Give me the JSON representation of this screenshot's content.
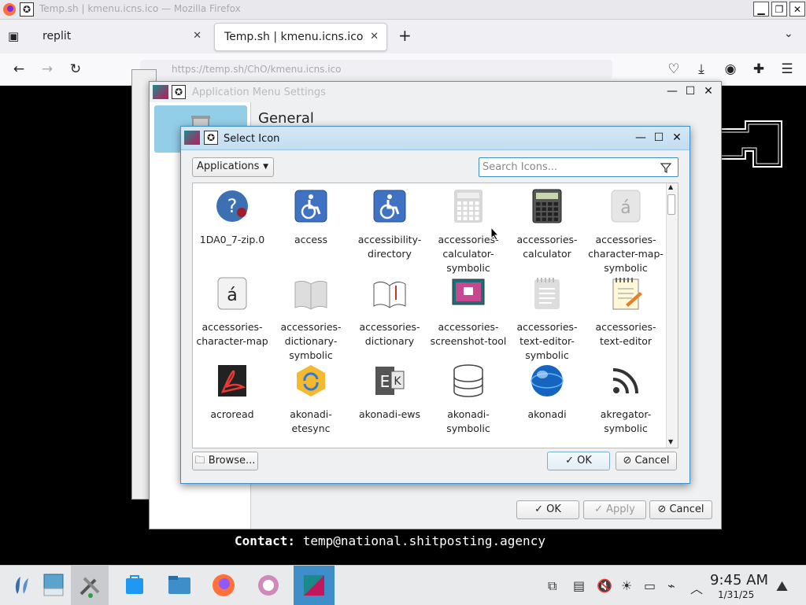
{
  "firefox": {
    "window_title": "Temp.sh | kmenu.icns.ico — Mozilla Firefox",
    "tabs": [
      {
        "label": "replit"
      },
      {
        "label": "Temp.sh | kmenu.icns.ico"
      }
    ],
    "url": "https://temp.sh/ChO/kmenu.icns.ico"
  },
  "page": {
    "contact_label": "Contact:",
    "contact_email": "temp@national.shitposting.agency"
  },
  "app_menu_settings": {
    "title": "Application Menu Settings",
    "section_title": "General",
    "ok_label": "OK",
    "apply_label": "Apply",
    "cancel_label": "Cancel"
  },
  "select_icon": {
    "title": "Select Icon",
    "category": "Applications",
    "search_placeholder": "Search Icons...",
    "browse_label": "Browse...",
    "ok_label": "OK",
    "cancel_label": "Cancel",
    "icons": [
      {
        "label": "1DA0_7-zip.0",
        "icon": "help-wine-icon"
      },
      {
        "label": "access",
        "icon": "wheelchair-icon"
      },
      {
        "label": "accessibility-directory",
        "icon": "wheelchair-icon"
      },
      {
        "label": "accessories-calculator-symbolic",
        "icon": "calculator-symbolic-icon"
      },
      {
        "label": "accessories-calculator",
        "icon": "calculator-icon"
      },
      {
        "label": "accessories-character-map-symbolic",
        "icon": "character-map-symbolic-icon"
      },
      {
        "label": "accessories-character-map",
        "icon": "character-map-icon"
      },
      {
        "label": "accessories-dictionary-symbolic",
        "icon": "dictionary-symbolic-icon"
      },
      {
        "label": "accessories-dictionary",
        "icon": "dictionary-icon"
      },
      {
        "label": "accessories-screenshot-tool",
        "icon": "screenshot-icon"
      },
      {
        "label": "accessories-text-editor-symbolic",
        "icon": "text-editor-symbolic-icon"
      },
      {
        "label": "accessories-text-editor",
        "icon": "text-editor-icon"
      },
      {
        "label": "acroread",
        "icon": "acrobat-icon"
      },
      {
        "label": "akonadi-etesync",
        "icon": "etesync-icon"
      },
      {
        "label": "akonadi-ews",
        "icon": "exchange-icon"
      },
      {
        "label": "akonadi-symbolic",
        "icon": "database-icon"
      },
      {
        "label": "akonadi",
        "icon": "akonadi-sphere-icon"
      },
      {
        "label": "akregator-symbolic",
        "icon": "rss-icon"
      }
    ]
  },
  "taskbar": {
    "time": "9:45 AM",
    "date": "1/31/25"
  },
  "colors": {
    "selection": "#93cee9",
    "accent": "#3d8ec9"
  }
}
